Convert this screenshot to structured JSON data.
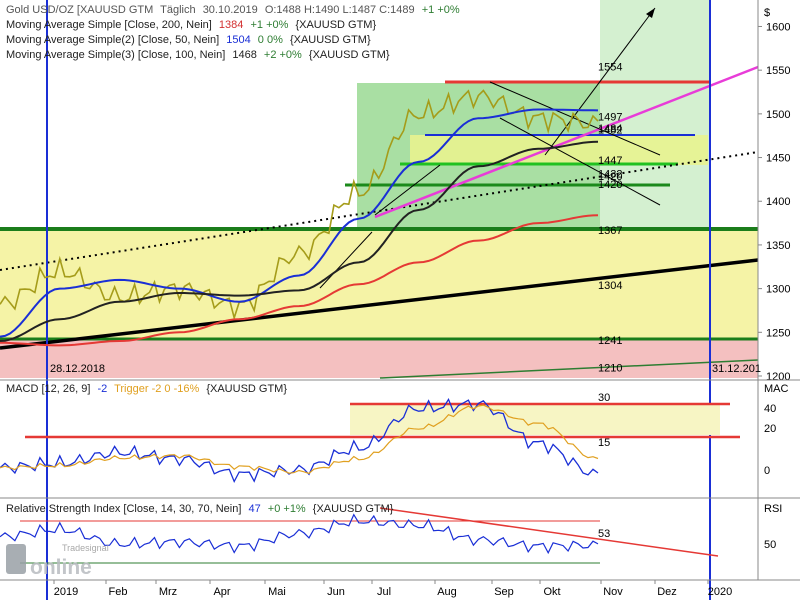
{
  "header": {
    "instrument": "Gold USD/OZ [XAUUSD GTM",
    "period": "Täglich",
    "date": "30.10.2019",
    "ohlc": "O:1488 H:1490 L:1487 C:1489",
    "change": "+1 +0%"
  },
  "indicators": [
    {
      "label": "Moving Average Simple [Close, 200, Nein]",
      "value": "1384",
      "change": "+1 +0%",
      "suffix": "{XAUUSD GTM}",
      "color": "#d32f2f"
    },
    {
      "label": "Moving Average Simple(2) [Close, 50, Nein]",
      "value": "1504",
      "change": "0 0%",
      "suffix": "{XAUUSD GTM}",
      "color": "#1a2fd6"
    },
    {
      "label": "Moving Average Simple(3) [Close, 100, Nein]",
      "value": "1468",
      "change": "+2 +0%",
      "suffix": "{XAUUSD GTM}",
      "color": "#2e7d32"
    }
  ],
  "currency_label": "$",
  "price_axis": [
    "1600",
    "1550",
    "1500",
    "1450",
    "1400",
    "1350",
    "1300",
    "1250",
    "1200"
  ],
  "price_levels": [
    {
      "label": "1554",
      "value": 1554,
      "color": "#e53935"
    },
    {
      "label": "1497",
      "value": 1497,
      "color": "#000000"
    },
    {
      "label": "1484",
      "value": 1484,
      "color": "#1a2fd6"
    },
    {
      "label": "1482",
      "value": 1482,
      "color": "#000000"
    },
    {
      "label": "1447",
      "value": 1447,
      "color": "#2e7d32"
    },
    {
      "label": "1432",
      "value": 1432,
      "color": "#000000"
    },
    {
      "label": "1420",
      "value": 1420,
      "color": "#000000"
    },
    {
      "label": "1420",
      "value": 1420,
      "color": "#2e7d32"
    },
    {
      "label": "1367",
      "value": 1367,
      "color": "#2e7d32"
    },
    {
      "label": "1304",
      "value": 1304,
      "color": "#000000"
    },
    {
      "label": "1241",
      "value": 1241,
      "color": "#2e7d32"
    },
    {
      "label": "1210",
      "value": 1210,
      "color": "#2e7d32"
    }
  ],
  "date_markers": {
    "start": "28.12.2018",
    "end": "31.12.201"
  },
  "macd": {
    "title": "MACD [12, 26, 9]",
    "value": "-2",
    "trigger": "Trigger -2 0 -16%",
    "suffix": "{XAUUSD GTM}",
    "axis_label": "MAC",
    "axis": [
      "40",
      "20",
      "0"
    ],
    "levels": [
      {
        "label": "30",
        "value": 30
      },
      {
        "label": "15",
        "value": 15
      }
    ]
  },
  "rsi": {
    "title": "Relative Strength Index [Close, 14, 30, 70, Nein]",
    "value": "47",
    "change": "+0 +1%",
    "suffix": "{XAUUSD GTM}",
    "axis_label": "RSI",
    "axis": [
      "50"
    ],
    "level_label": "53"
  },
  "watermark": {
    "brand": "Tradesignal",
    "product": "online"
  },
  "x_axis": [
    "2019",
    "Feb",
    "Mrz",
    "Apr",
    "Mai",
    "Jun",
    "Jul",
    "Aug",
    "Sep",
    "Okt",
    "Nov",
    "Dez",
    "2020"
  ],
  "chart_data": {
    "type": "line",
    "title": "Gold USD/OZ [XAUUSD GTM",
    "xlabel": "",
    "ylabel": "",
    "ylim": [
      1200,
      1620
    ],
    "x": [
      "2019",
      "Feb",
      "Mrz",
      "Apr",
      "Mai",
      "Jun",
      "Jul",
      "Aug",
      "Sep",
      "Okt",
      "Nov"
    ],
    "series": [
      {
        "name": "Gold",
        "color": "#a59c1a",
        "values": [
          1282,
          1320,
          1290,
          1300,
          1280,
          1340,
          1410,
          1500,
          1520,
          1495,
          1489
        ]
      },
      {
        "name": "Moving Average Simple [Close, 200, Nein]",
        "color": "#e53935",
        "values": [
          1238,
          1235,
          1240,
          1250,
          1265,
          1280,
          1305,
          1330,
          1355,
          1375,
          1384
        ]
      },
      {
        "name": "Moving Average Simple(2) [Close, 50, Nein]",
        "color": "#1a2fd6",
        "values": [
          1245,
          1300,
          1310,
          1300,
          1285,
          1315,
          1380,
          1445,
          1495,
          1505,
          1504
        ]
      },
      {
        "name": "Moving Average Simple(3) [Close, 100, Nein]",
        "color": "#222222",
        "values": [
          1240,
          1265,
          1285,
          1295,
          1292,
          1298,
          1330,
          1390,
          1440,
          1460,
          1468
        ]
      }
    ],
    "macd": {
      "ylim": [
        -10,
        40
      ],
      "levels": [
        30,
        15
      ],
      "values": [
        1,
        3,
        8,
        5,
        -2,
        0,
        10,
        28,
        30,
        12,
        -2
      ]
    },
    "rsi": {
      "ylim": [
        25,
        75
      ],
      "levels": [
        30,
        70
      ],
      "values": [
        55,
        62,
        48,
        50,
        46,
        58,
        70,
        66,
        52,
        46,
        47
      ]
    }
  }
}
